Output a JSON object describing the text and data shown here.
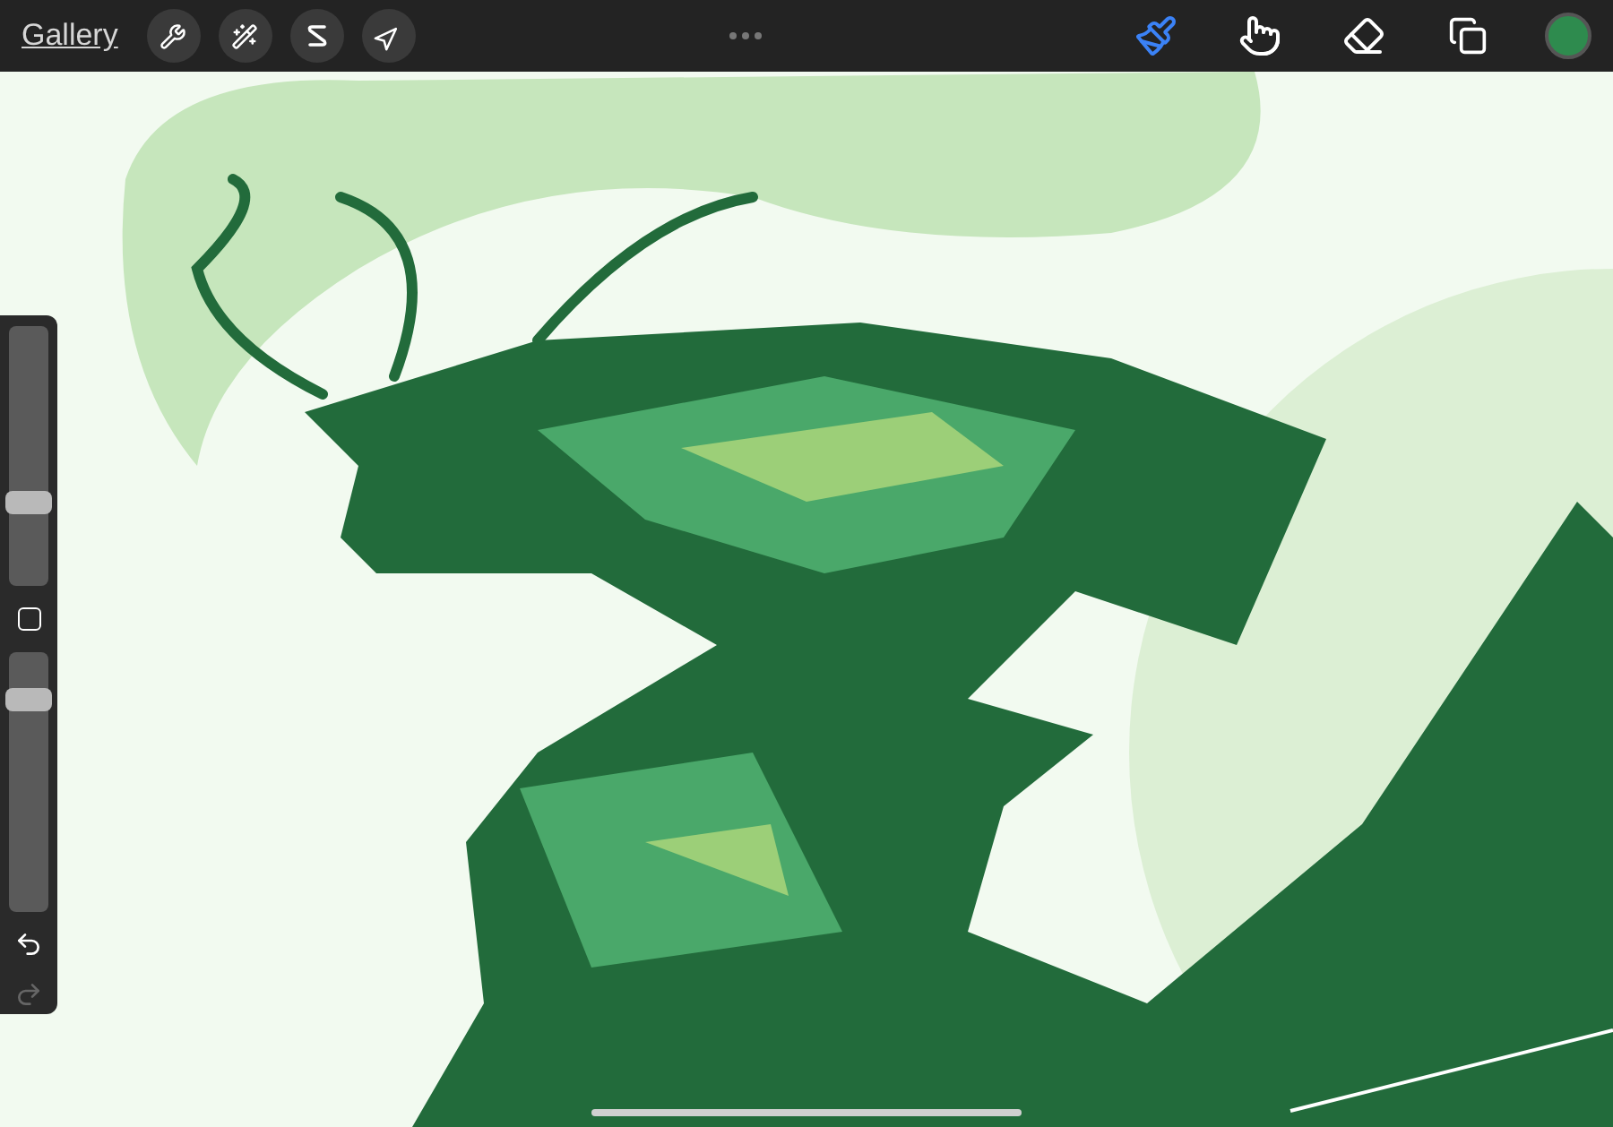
{
  "toolbar": {
    "gallery": "Gallery",
    "actions": [
      {
        "kind": "wrench"
      },
      {
        "kind": "wand"
      },
      {
        "kind": "selection"
      },
      {
        "kind": "transform"
      }
    ],
    "tools": [
      {
        "kind": "brush",
        "selected": true
      },
      {
        "kind": "smudge",
        "selected": false
      },
      {
        "kind": "eraser",
        "selected": false
      },
      {
        "kind": "layers",
        "selected": false
      }
    ],
    "color": "#2e8b4e"
  },
  "sidebar": {
    "size": {
      "level": 0.3
    },
    "opacity": {
      "level": 0.85
    }
  }
}
